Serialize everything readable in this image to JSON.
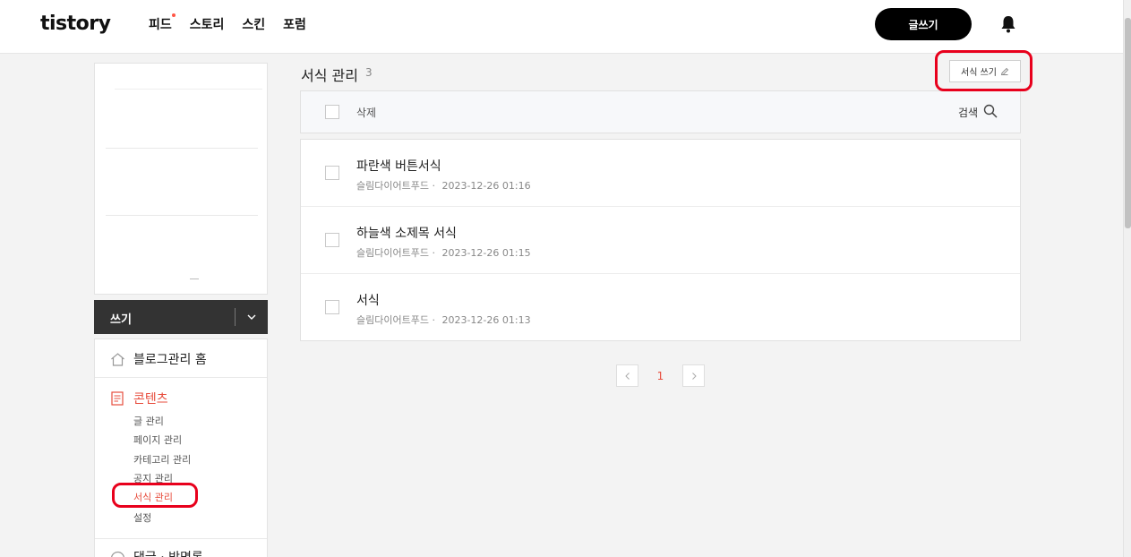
{
  "header": {
    "logo": "tistory",
    "nav": [
      "피드",
      "스토리",
      "스킨",
      "포럼"
    ],
    "write_button": "글쓰기",
    "bell_icon": "bell-icon"
  },
  "sidebar": {
    "dropdown_label": "쓰기",
    "home_label": "블로그관리 홈",
    "contents_label": "콘텐츠",
    "contents_items": [
      "글 관리",
      "페이지 관리",
      "카테고리 관리",
      "공지 관리",
      "서식 관리",
      "설정"
    ],
    "active_item": "서식 관리",
    "next_section_label": "댓글 · 방명록"
  },
  "main": {
    "title": "서식 관리",
    "count": "3",
    "new_template_button": "서식 쓰기",
    "toolbar": {
      "delete_label": "삭제",
      "search_label": "검색"
    },
    "items": [
      {
        "title": "파란색 버튼서식",
        "author": "슬림다이어트푸드",
        "separator": "·",
        "date": "2023-12-26 01:16"
      },
      {
        "title": "하늘색 소제목 서식",
        "author": "슬림다이어트푸드",
        "separator": "·",
        "date": "2023-12-26 01:15"
      },
      {
        "title": "서식",
        "author": "슬림다이어트푸드",
        "separator": "·",
        "date": "2023-12-26 01:13"
      }
    ],
    "pagination": {
      "current": "1"
    }
  },
  "colors": {
    "accent": "#e74c3c",
    "highlight": "#e8001c",
    "dark": "#333333"
  }
}
